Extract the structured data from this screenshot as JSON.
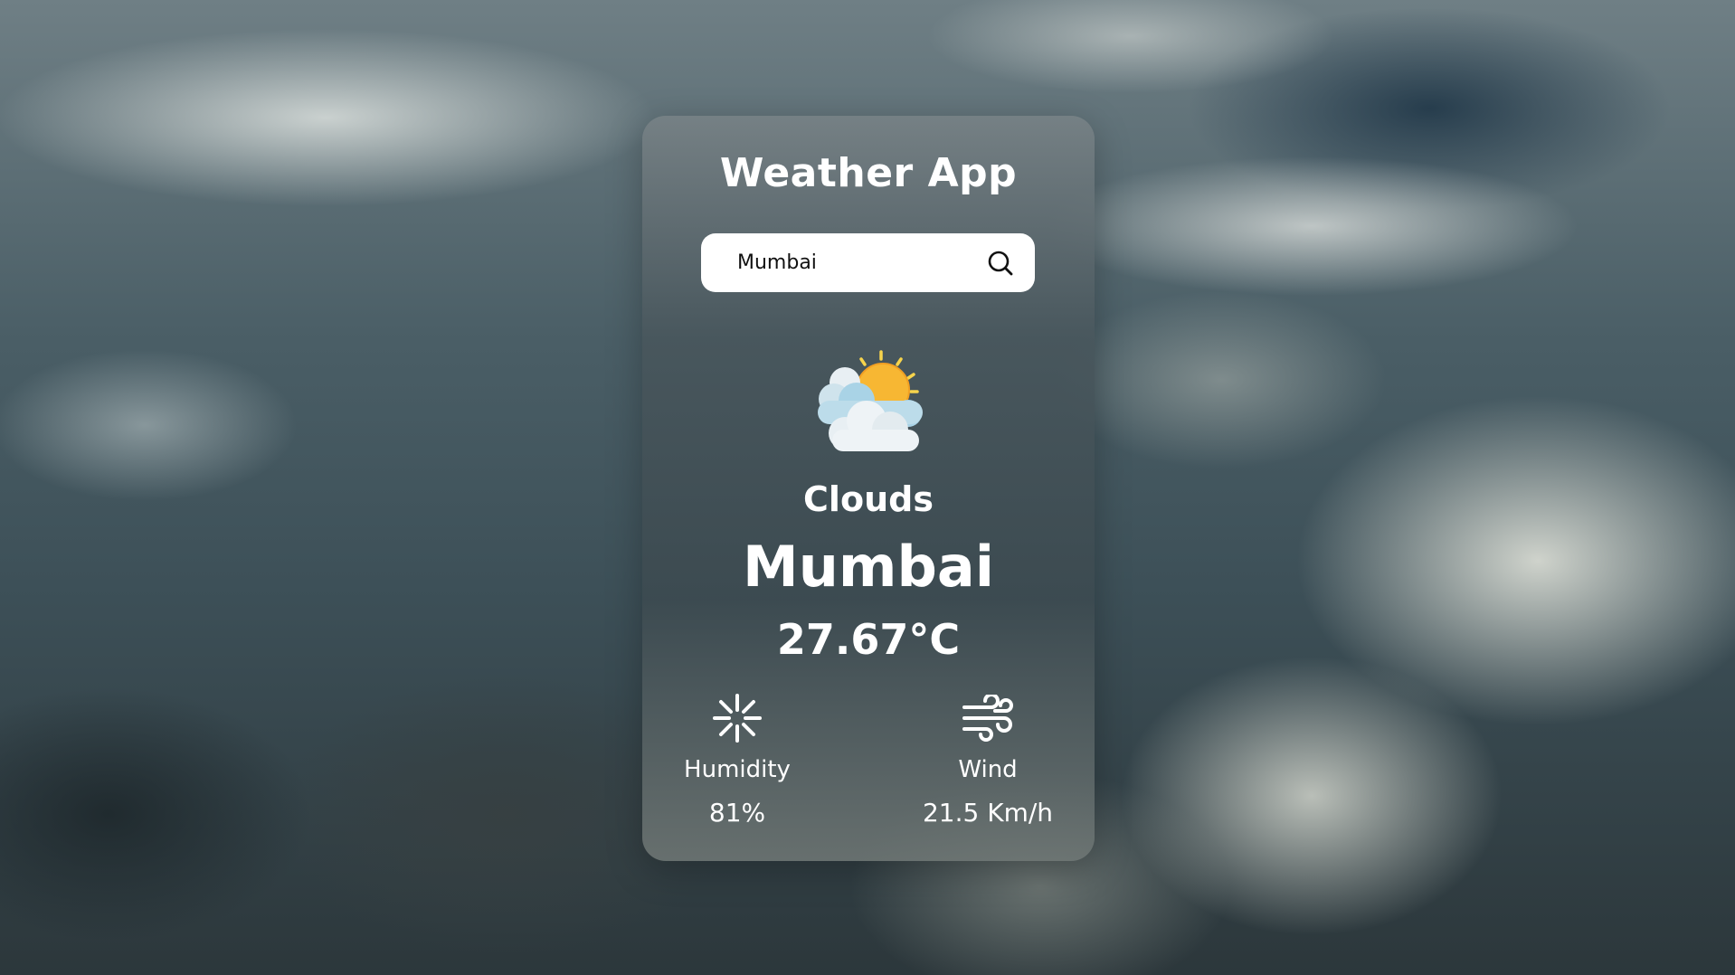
{
  "app": {
    "title": "Weather App"
  },
  "search": {
    "value": "Mumbai",
    "button_icon": "search-icon"
  },
  "weather": {
    "icon": "sun-behind-clouds-icon",
    "condition": "Clouds",
    "city": "Mumbai",
    "temperature": "27.67°C"
  },
  "stats": {
    "humidity": {
      "icon": "humidity-icon",
      "label": "Humidity",
      "value": "81%"
    },
    "wind": {
      "icon": "wind-icon",
      "label": "Wind",
      "value": "21.5 Km/h"
    }
  },
  "colors": {
    "card_text": "#ffffff",
    "search_bg": "#ffffff",
    "sun": "#f7b733",
    "cloud": "#e8eff3"
  }
}
